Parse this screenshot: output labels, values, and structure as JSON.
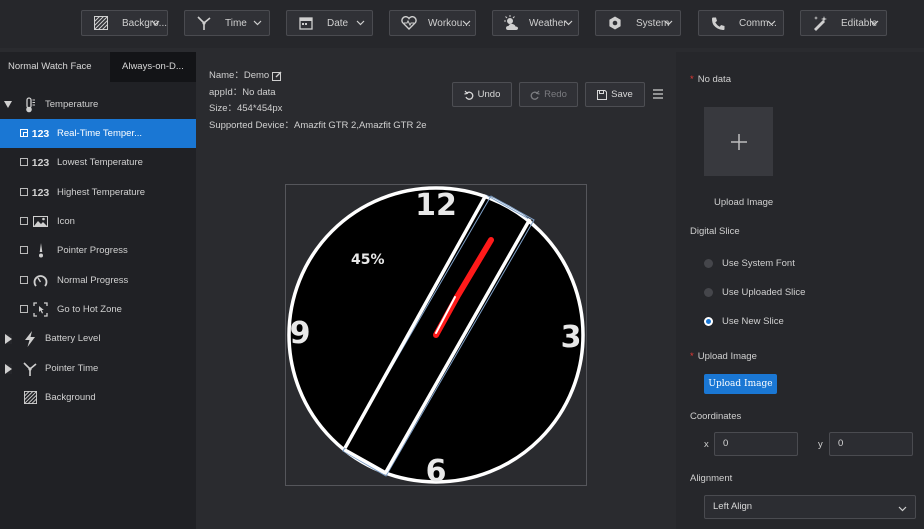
{
  "toolbar": {
    "items": [
      {
        "label": "Backgro...",
        "icon": "background-icon"
      },
      {
        "label": "Time",
        "icon": "pointer-time-icon"
      },
      {
        "label": "Date",
        "icon": "date-icon"
      },
      {
        "label": "Workou...",
        "icon": "heart-icon"
      },
      {
        "label": "Weather",
        "icon": "weather-icon"
      },
      {
        "label": "System",
        "icon": "system-icon"
      },
      {
        "label": "Comm...",
        "icon": "phone-icon"
      },
      {
        "label": "Editable",
        "icon": "editable-icon"
      }
    ]
  },
  "left": {
    "tabs": [
      "Normal Watch Face",
      "Always-on-D..."
    ],
    "groups": [
      {
        "label": "Temperature",
        "expanded": true
      },
      {
        "label": "Battery Level",
        "expanded": false
      },
      {
        "label": "Pointer Time",
        "expanded": false
      },
      {
        "label": "Background"
      }
    ],
    "children": [
      {
        "label": "Real-Time Temper...",
        "icon": "digits-icon",
        "selected": true
      },
      {
        "label": "Lowest Temperature",
        "icon": "digits-icon"
      },
      {
        "label": "Highest Temperature",
        "icon": "digits-icon"
      },
      {
        "label": "Icon",
        "icon": "image-icon"
      },
      {
        "label": "Pointer Progress",
        "icon": "pointer-progress-icon"
      },
      {
        "label": "Normal Progress",
        "icon": "gauge-icon"
      },
      {
        "label": "Go to Hot Zone",
        "icon": "hot-zone-icon"
      }
    ]
  },
  "info": {
    "name_label": "Name：",
    "name_value": "Demo",
    "appid_label": "appId：",
    "appid_value": "No data",
    "size_label": "Size：",
    "size_value": "454*454px",
    "device_label": "Supported Device：",
    "device_value": "Amazfit GTR 2,Amazfit GTR 2e"
  },
  "actions": {
    "undo": "Undo",
    "redo": "Redo",
    "save": "Save"
  },
  "watch": {
    "numerals": [
      "12",
      "3",
      "6",
      "9"
    ],
    "percent": "45%"
  },
  "right": {
    "no_data": "No data",
    "upload_image_caption": "Upload Image",
    "digital_slice": "Digital Slice",
    "radios": [
      {
        "label": "Use System Font",
        "checked": false
      },
      {
        "label": "Use Uploaded Slice",
        "checked": false
      },
      {
        "label": "Use New Slice",
        "checked": true
      }
    ],
    "upload_image_label": "Upload Image",
    "upload_image_button": "Upload Image",
    "coordinates_label": "Coordinates",
    "x_label": "x",
    "x_value": "0",
    "y_label": "y",
    "y_value": "0",
    "alignment_label": "Alignment",
    "alignment_value": "Left Align"
  },
  "colors": {
    "accent": "#1a77d4",
    "required": "#e53935",
    "progress": "#ff1a1a"
  }
}
